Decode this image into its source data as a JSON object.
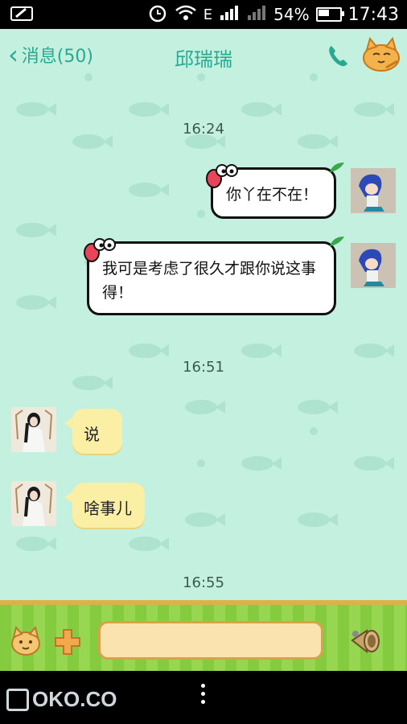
{
  "status_bar": {
    "battery_percent": "54%",
    "time": "17:43"
  },
  "header": {
    "back_label": "消息(50)",
    "contact_name": "邱瑞瑞"
  },
  "messages": [
    {
      "type": "timestamp",
      "text": "16:24"
    },
    {
      "type": "sent",
      "text": "你丫在不在！"
    },
    {
      "type": "sent",
      "text": "我可是考虑了很久才跟你说这事得！"
    },
    {
      "type": "timestamp",
      "text": "16:51"
    },
    {
      "type": "received",
      "text": "说"
    },
    {
      "type": "received",
      "text": "啥事儿"
    },
    {
      "type": "timestamp",
      "text": "16:55"
    }
  ],
  "input": {
    "placeholder": ""
  },
  "watermark": "OKO.CO",
  "colors": {
    "background": "#c4f0df",
    "accent": "#2aa891",
    "received_bubble": "#fbefa6",
    "input_bar": "#8fd24a"
  }
}
